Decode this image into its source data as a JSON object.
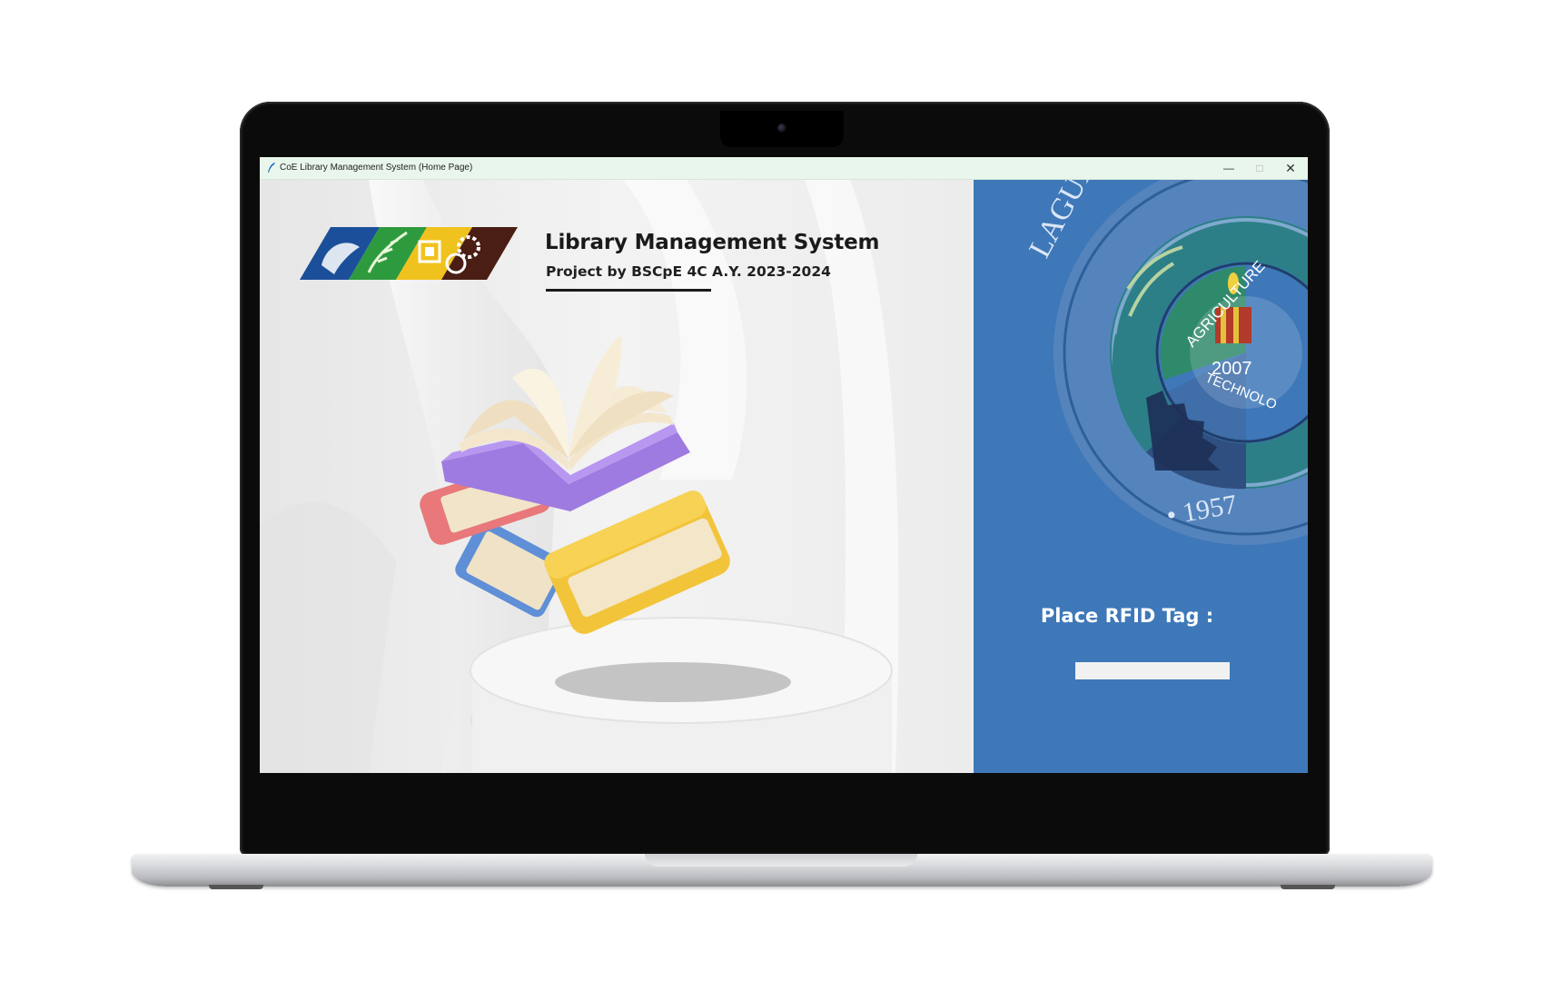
{
  "window": {
    "title": "CoE Library Management System (Home Page)",
    "controls": {
      "minimize": "—",
      "maximize": "□",
      "close": "✕"
    }
  },
  "header": {
    "title": "Library Management System",
    "subtitle": "Project by BSCpE 4C A.Y. 2023-2024"
  },
  "seal": {
    "ring_text": "LAGUNA STATE P",
    "inner_text_top": "AGRICULTURE",
    "inner_text_bottom": "TECHNOLO",
    "year_inner": "2007",
    "year_outer": "• 1957"
  },
  "rfid": {
    "label": "Place RFID Tag :",
    "value": ""
  },
  "icons": {
    "app": "feather-icon",
    "logo": "coe-department-logo",
    "illustration": "books-illustration"
  },
  "colors": {
    "right_panel": "#3e78b9",
    "titlebar": "#e9f6ec"
  }
}
